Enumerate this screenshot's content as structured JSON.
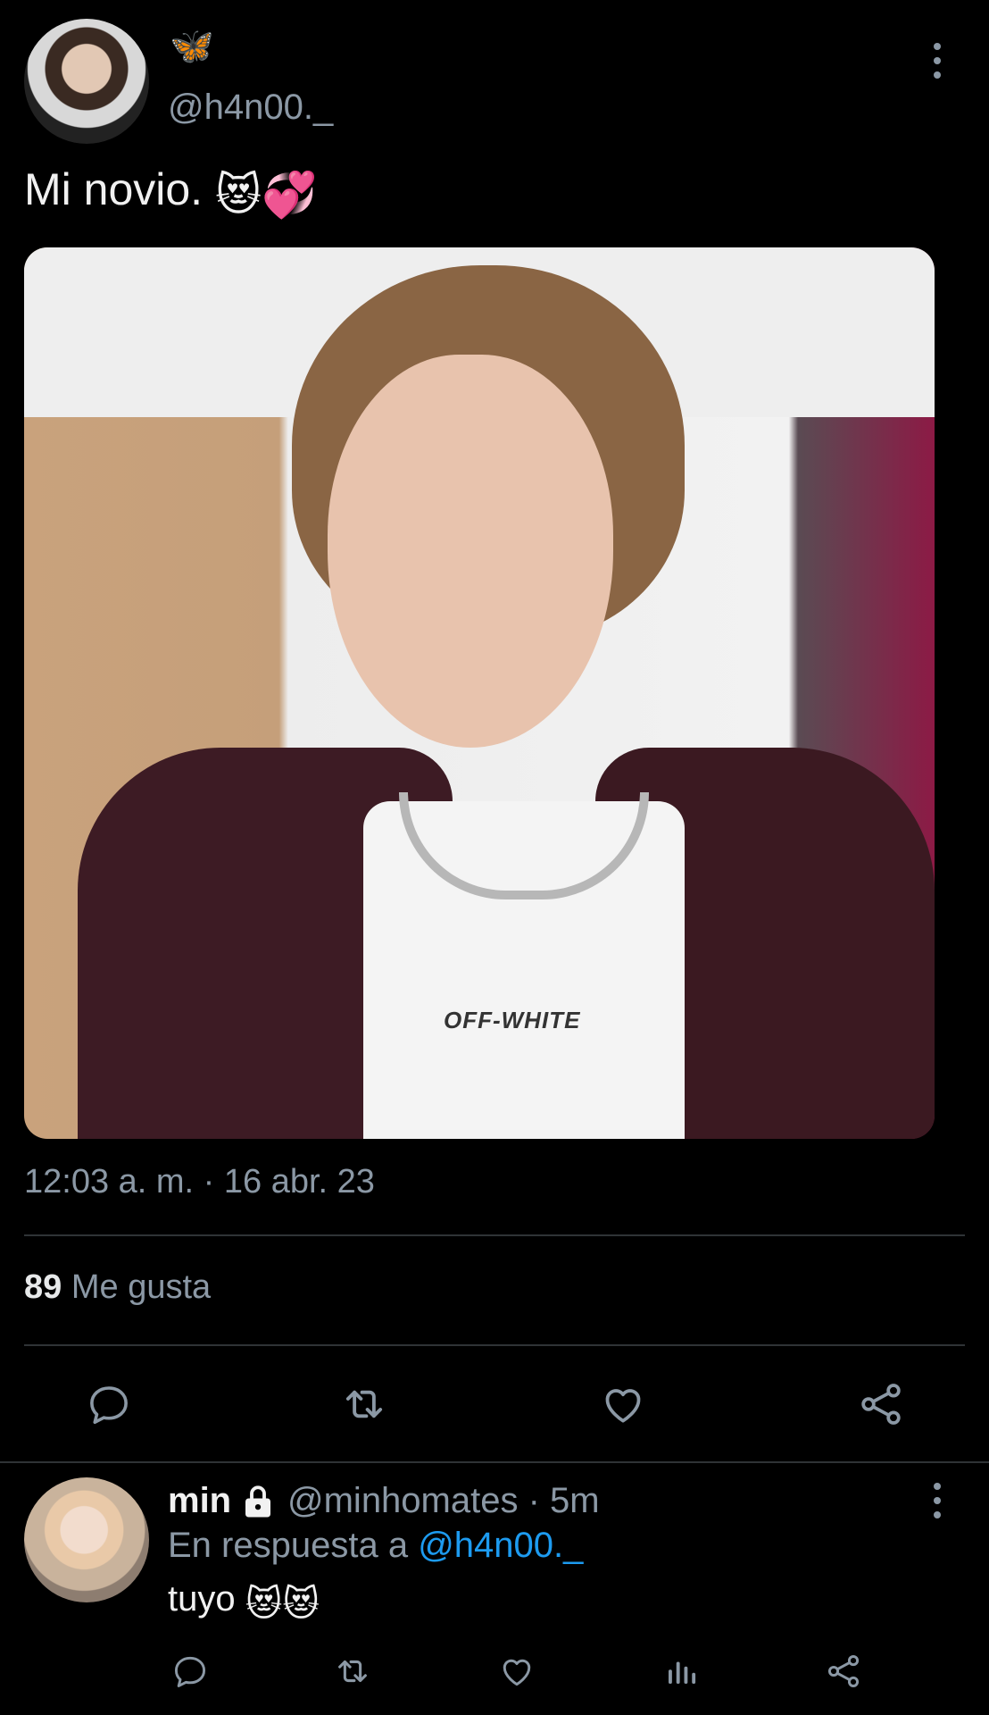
{
  "tweet": {
    "name_emoji": "🦋",
    "handle": "@h4n00._",
    "text": "Mi novio.",
    "text_emojis": "😻💞",
    "image_text": "OFF-WHITE",
    "timestamp": "12:03 a. m. · 16 abr. 23",
    "likes_count": "89",
    "likes_label": "Me gusta",
    "actions": [
      "reply-icon",
      "retweet-icon",
      "like-icon",
      "share-icon"
    ]
  },
  "reply": {
    "name": "min",
    "handle_time": "@minhomates · 5m",
    "reply_prefix": "En respuesta a ",
    "reply_mention": "@h4n00._",
    "text": "tuyo",
    "text_emojis": "😻😻",
    "actions": [
      "reply-icon",
      "retweet-icon",
      "like-icon",
      "views-icon",
      "share-icon"
    ]
  },
  "colors": {
    "background": "#000000",
    "muted": "#8b98a5",
    "link": "#1d9bf0",
    "divider": "#2f3336"
  }
}
